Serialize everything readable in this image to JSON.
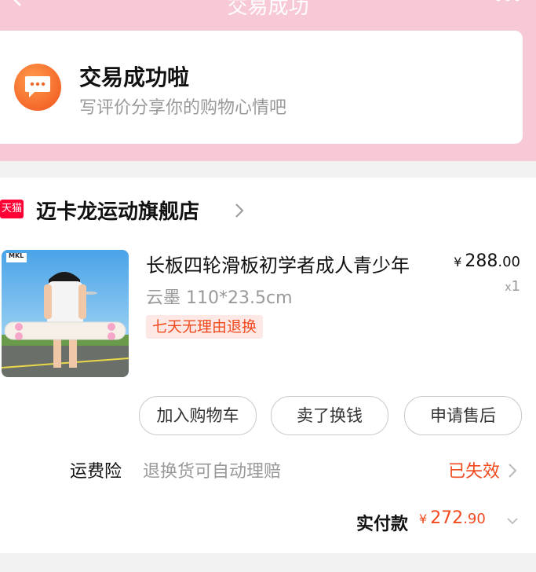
{
  "nav": {
    "title": "交易成功"
  },
  "status": {
    "title": "交易成功啦",
    "subtitle": "写评价分享你的购物心情吧",
    "icon": "chat-bubble-icon"
  },
  "shop": {
    "badge": "天猫",
    "name": "迈卡龙运动旗舰店"
  },
  "product": {
    "title": "长板四轮滑板初学者成人青少年",
    "spec": "云墨 110*23.5cm",
    "badge": "七天无理由退换",
    "price_currency": "¥",
    "price_int": "288",
    "price_dec": ".00",
    "qty_x": "x",
    "qty": "1",
    "image_brand": "MKL"
  },
  "actions": {
    "add_cart": "加入购物车",
    "resell": "卖了换钱",
    "after_sale": "申请售后"
  },
  "insurance": {
    "label": "运费险",
    "desc": "退换货可自动理赔",
    "status": "已失效"
  },
  "payment": {
    "label": "实付款",
    "currency": "¥",
    "amount_int": "272",
    "amount_dec": ".90"
  },
  "colors": {
    "brand_pink": "#f7c8d6",
    "accent_orange": "#f04a1e",
    "tmall_red": "#ff0036"
  }
}
